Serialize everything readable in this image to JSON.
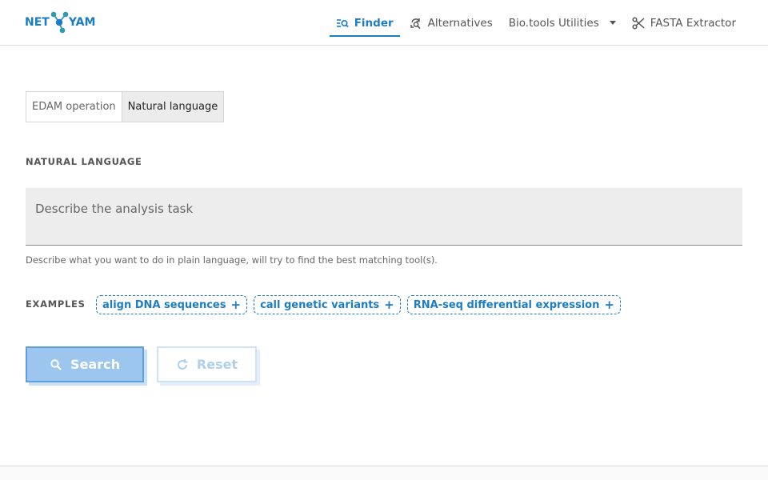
{
  "header": {
    "logo_text_left": "NET",
    "logo_text_right": "YAM",
    "nav": [
      {
        "label": "Finder",
        "icon": "finder-icon",
        "active": true
      },
      {
        "label": "Alternatives",
        "icon": "alternatives-icon"
      },
      {
        "label": "Bio.tools Utilities",
        "icon": "chevron-down-icon"
      },
      {
        "label": "FASTA Extractor",
        "icon": "scissors-icon"
      }
    ]
  },
  "mode_toggle": {
    "options": [
      "EDAM operation",
      "Natural language"
    ],
    "selected": "Natural language"
  },
  "form": {
    "section_label": "NATURAL LANGUAGE",
    "placeholder": "Describe the analysis task",
    "value": "",
    "hint": "Describe what you want to do in plain language, will try to find the best matching tool(s)."
  },
  "examples": {
    "label": "EXAMPLES",
    "items": [
      "align DNA sequences",
      "call genetic variants",
      "RNA-seq differential expression"
    ]
  },
  "actions": {
    "search_label": "Search",
    "reset_label": "Reset"
  },
  "colors": {
    "accent": "#1c7cc4",
    "search_button_bg": "#9cc6ee",
    "input_bg": "#ededed"
  }
}
